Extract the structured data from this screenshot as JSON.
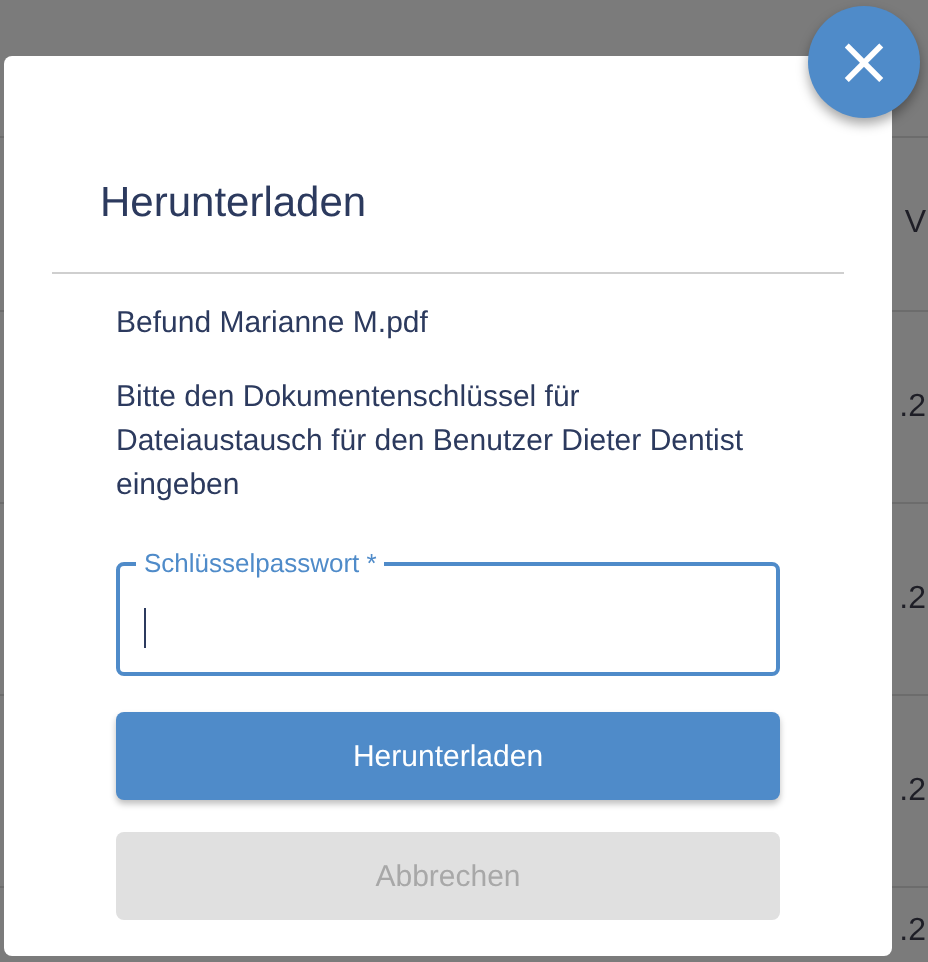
{
  "background_table": {
    "header_fragment": "V",
    "cell_fragments": [
      ".2",
      ".2",
      ".2",
      ".2"
    ]
  },
  "dialog": {
    "close_icon": "×",
    "title": "Herunterladen",
    "file_name": "Befund Marianne M.pdf",
    "message": "Bitte den Dokumentenschlüssel für Dateiaustausch für den Benutzer Dieter Dentist eingeben",
    "field": {
      "label": "Schlüsselpasswort *",
      "focused": true
    },
    "buttons": [
      {
        "label": "Herunterladen",
        "kind": "primary"
      },
      {
        "label": "Abbrechen",
        "kind": "secondary"
      }
    ]
  }
}
